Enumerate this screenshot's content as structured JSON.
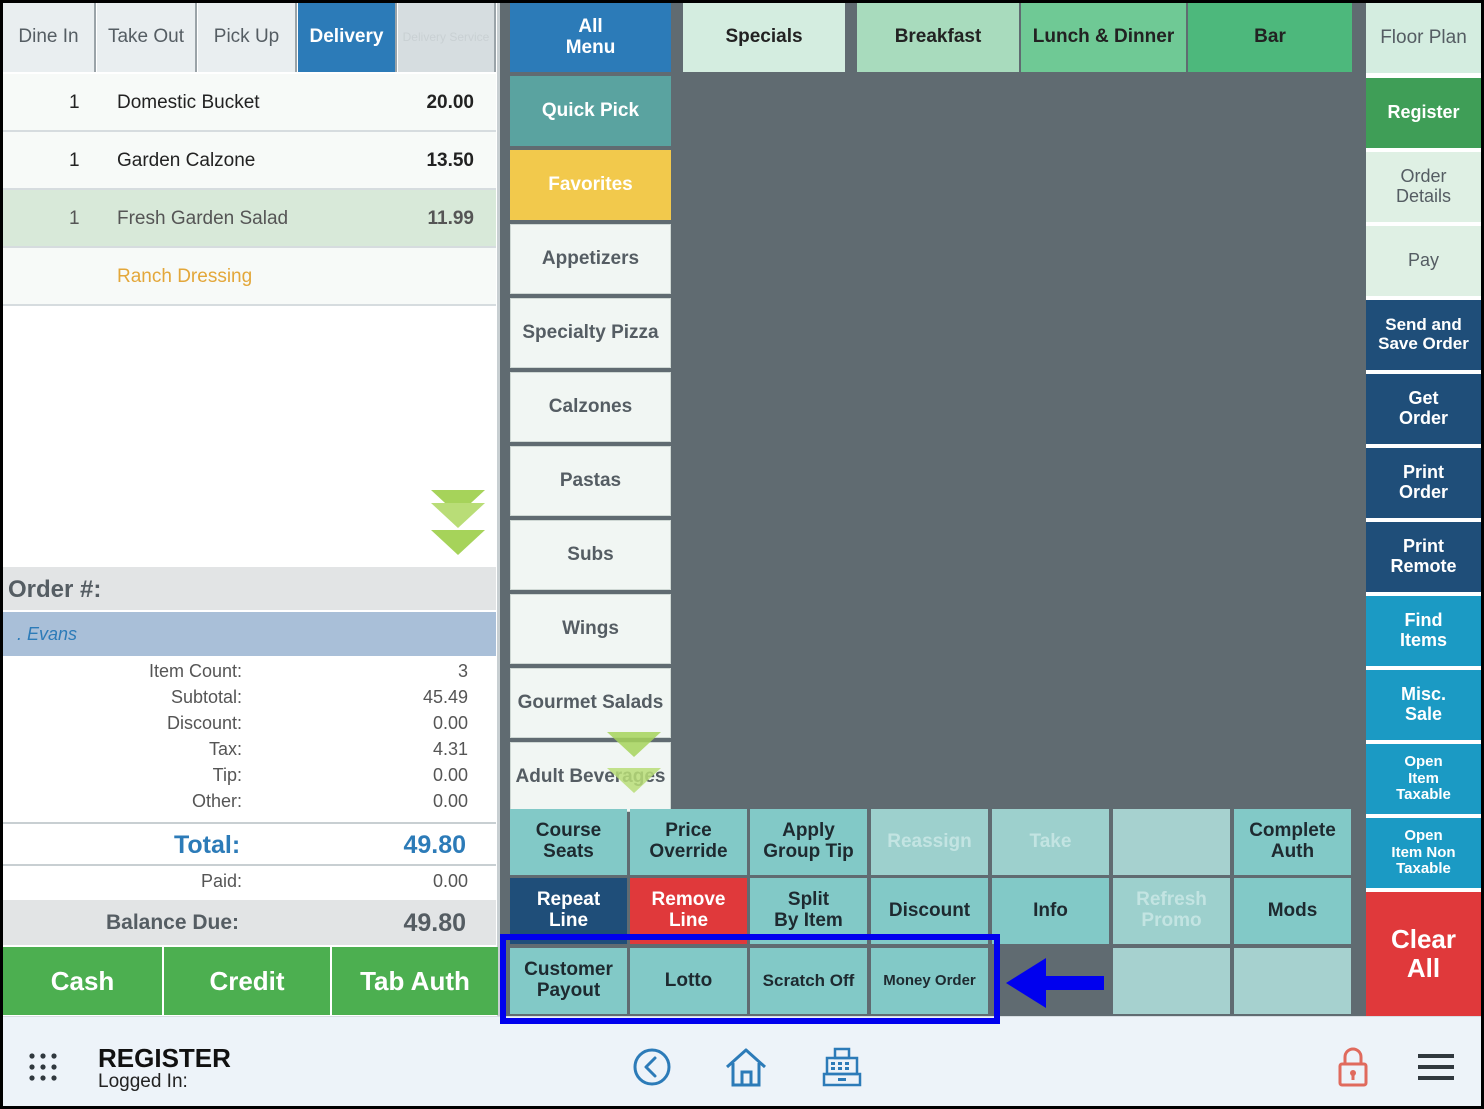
{
  "order_tabs": [
    {
      "label": "Dine In",
      "state": "normal"
    },
    {
      "label": "Take Out",
      "state": "normal"
    },
    {
      "label": "Pick Up",
      "state": "normal"
    },
    {
      "label": "Delivery",
      "state": "active"
    },
    {
      "label": "Delivery Service",
      "state": "disabled"
    }
  ],
  "order_items": [
    {
      "qty": "1",
      "name": "Domestic Bucket",
      "price": "20.00"
    },
    {
      "qty": "1",
      "name": "Garden Calzone",
      "price": "13.50"
    },
    {
      "qty": "1",
      "name": "Fresh Garden Salad",
      "price": "11.99"
    },
    {
      "qty": "",
      "name": "Ranch Dressing",
      "price": ""
    }
  ],
  "order": {
    "number_label": "Order #:",
    "customer": ". Evans",
    "summary": [
      {
        "label": "Item Count:",
        "value": "3"
      },
      {
        "label": "Subtotal:",
        "value": "45.49"
      },
      {
        "label": "Discount:",
        "value": "0.00"
      },
      {
        "label": "Tax:",
        "value": "4.31"
      },
      {
        "label": "Tip:",
        "value": "0.00"
      },
      {
        "label": "Other:",
        "value": "0.00"
      }
    ],
    "total_label": "Total:",
    "total_value": "49.80",
    "paid_label": "Paid:",
    "paid_value": "0.00",
    "balance_label": "Balance Due:",
    "balance_value": "49.80"
  },
  "payment_buttons": [
    "Cash",
    "Credit",
    "Tab Auth"
  ],
  "menu_tabs": [
    "All\nMenu",
    "Specials",
    "Breakfast",
    "Lunch & Dinner",
    "Bar"
  ],
  "categories": [
    "Quick Pick",
    "Favorites",
    "Appetizers",
    "Specialty Pizza",
    "Calzones",
    "Pastas",
    "Subs",
    "Wings",
    "Gourmet Salads",
    "Adult Beverages"
  ],
  "right_buttons": [
    "Floor Plan",
    "Register",
    "Order\nDetails",
    "Pay",
    "Send and\nSave Order",
    "Get\nOrder",
    "Print\nOrder",
    "Print\nRemote",
    "Find\nItems",
    "Misc.\nSale",
    "Open\nItem\nTaxable",
    "Open\nItem Non\nTaxable",
    "Clear\nAll"
  ],
  "function_grid": {
    "row1": [
      "Course\nSeats",
      "Price\nOverride",
      "Apply\nGroup Tip",
      "Reassign",
      "Take",
      "",
      "Complete\nAuth"
    ],
    "row2": [
      "Repeat\nLine",
      "Remove\nLine",
      "Split\nBy Item",
      "Discount",
      "Info",
      "Refresh\nPromo",
      "Mods"
    ],
    "row3": [
      "Customer\nPayout",
      "Lotto",
      "Scratch Off",
      "Money Order",
      "",
      ""
    ]
  },
  "footer": {
    "title": "REGISTER",
    "subtitle": "Logged In:"
  },
  "colors": {
    "accent_blue": "#2c7bb8",
    "green": "#4caf50",
    "red": "#e0393b",
    "navy": "#1f4e79",
    "teal": "#82c9c7",
    "highlight": "#0000ee"
  }
}
